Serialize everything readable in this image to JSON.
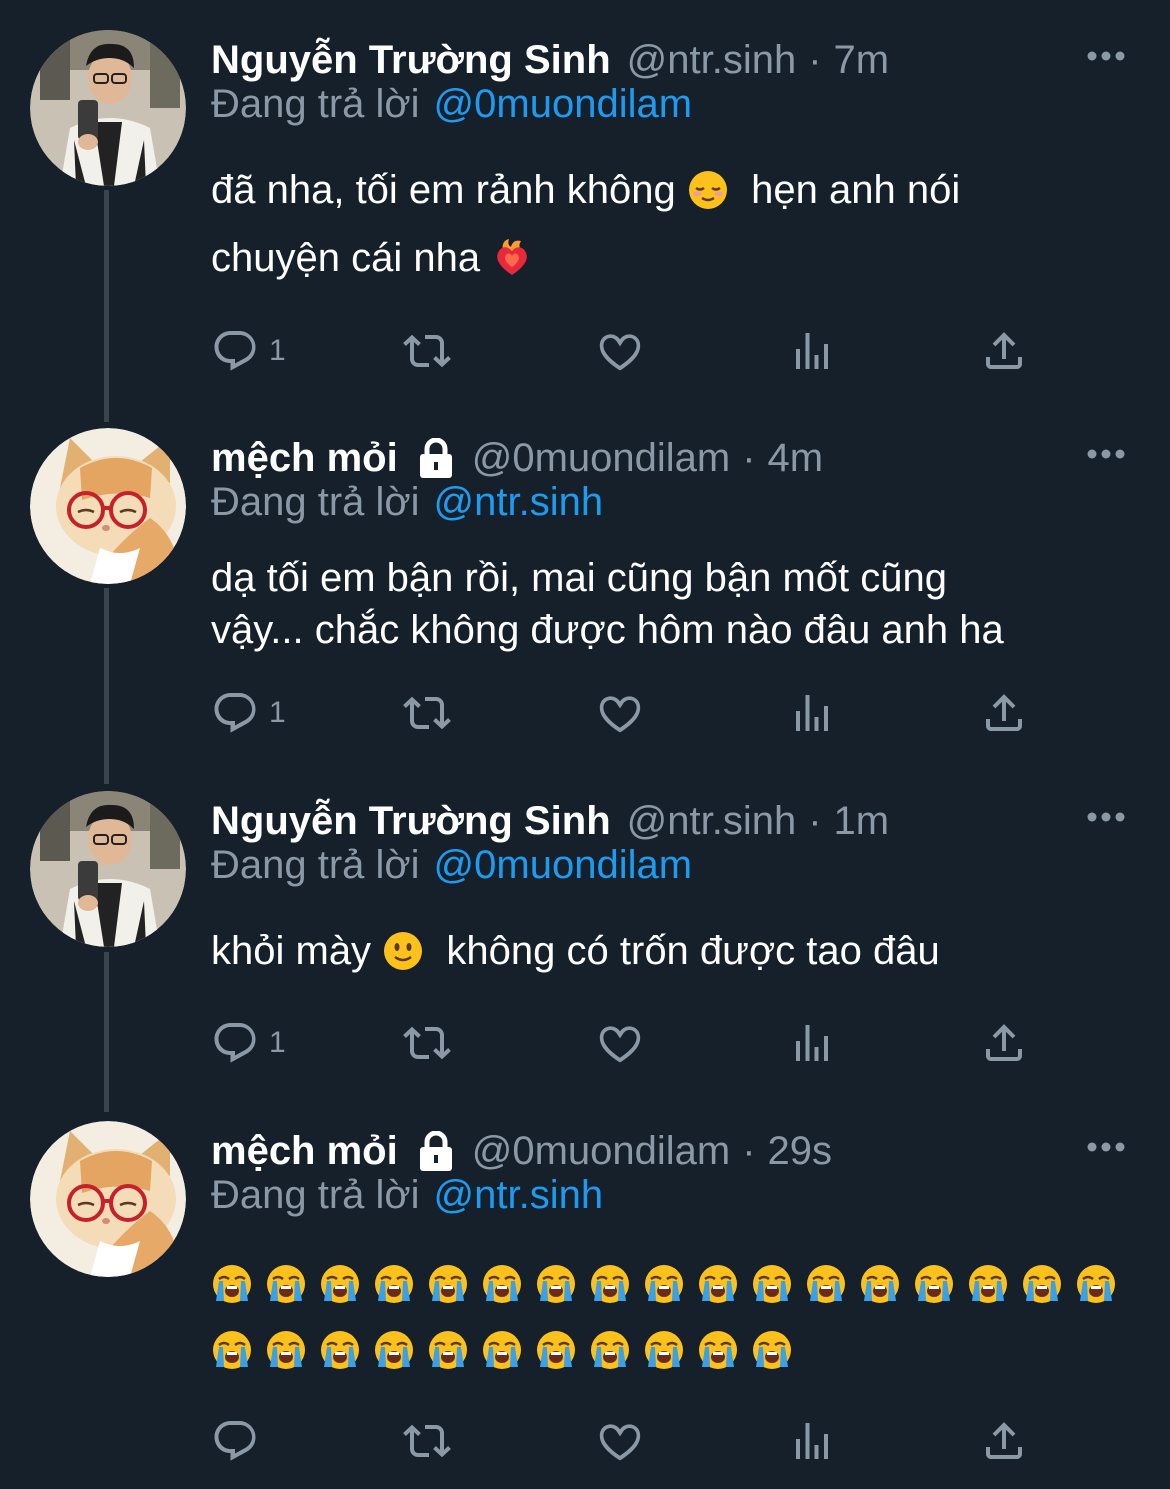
{
  "colors": {
    "background": "#15202b",
    "text": "#ffffff",
    "muted": "#8b98a5",
    "link": "#1d9bf0",
    "thread_line": "#3a444c"
  },
  "tweets": [
    {
      "display_name": "Nguyễn Trường Sinh",
      "handle": "@ntr.sinh",
      "separator": "·",
      "time": "7m",
      "protected": false,
      "reply_prefix": "Đang trả lời",
      "reply_to": "@0muondilam",
      "text_lines": [
        "đã nha, tối em rảnh không",
        "hẹn anh nói",
        "chuyện cái nha"
      ],
      "emojis": [
        "relieved-face-emoji",
        "heart-on-fire-emoji"
      ],
      "reply_count": "1",
      "avatar": "man-selfie-avatar"
    },
    {
      "display_name": "mệch mỏi",
      "handle": "@0muondilam",
      "separator": "·",
      "time": "4m",
      "protected": true,
      "reply_prefix": "Đang trả lời",
      "reply_to": "@ntr.sinh",
      "text_lines": [
        "dạ tối em bận rồi, mai cũng bận mốt cũng",
        "vậy... chắc không được hôm nào đâu anh ha"
      ],
      "reply_count": "1",
      "avatar": "cat-with-glasses-avatar"
    },
    {
      "display_name": "Nguyễn Trường Sinh",
      "handle": "@ntr.sinh",
      "separator": "·",
      "time": "1m",
      "protected": false,
      "reply_prefix": "Đang trả lời",
      "reply_to": "@0muondilam",
      "text_lines": [
        "khỏi mày",
        "không có trốn được tao đâu"
      ],
      "emojis": [
        "slightly-smiling-face-emoji"
      ],
      "reply_count": "1",
      "avatar": "man-selfie-avatar"
    },
    {
      "display_name": "mệch mỏi",
      "handle": "@0muondilam",
      "separator": "·",
      "time": "29s",
      "protected": true,
      "reply_prefix": "Đang trả lời",
      "reply_to": "@ntr.sinh",
      "emoji_rows": [
        17,
        11
      ],
      "emoji_name": "loudly-crying-face-emoji",
      "reply_count": "",
      "avatar": "cat-with-glasses-avatar"
    }
  ],
  "action_icons": [
    "reply-icon",
    "retweet-icon",
    "like-icon",
    "views-icon",
    "share-icon"
  ]
}
